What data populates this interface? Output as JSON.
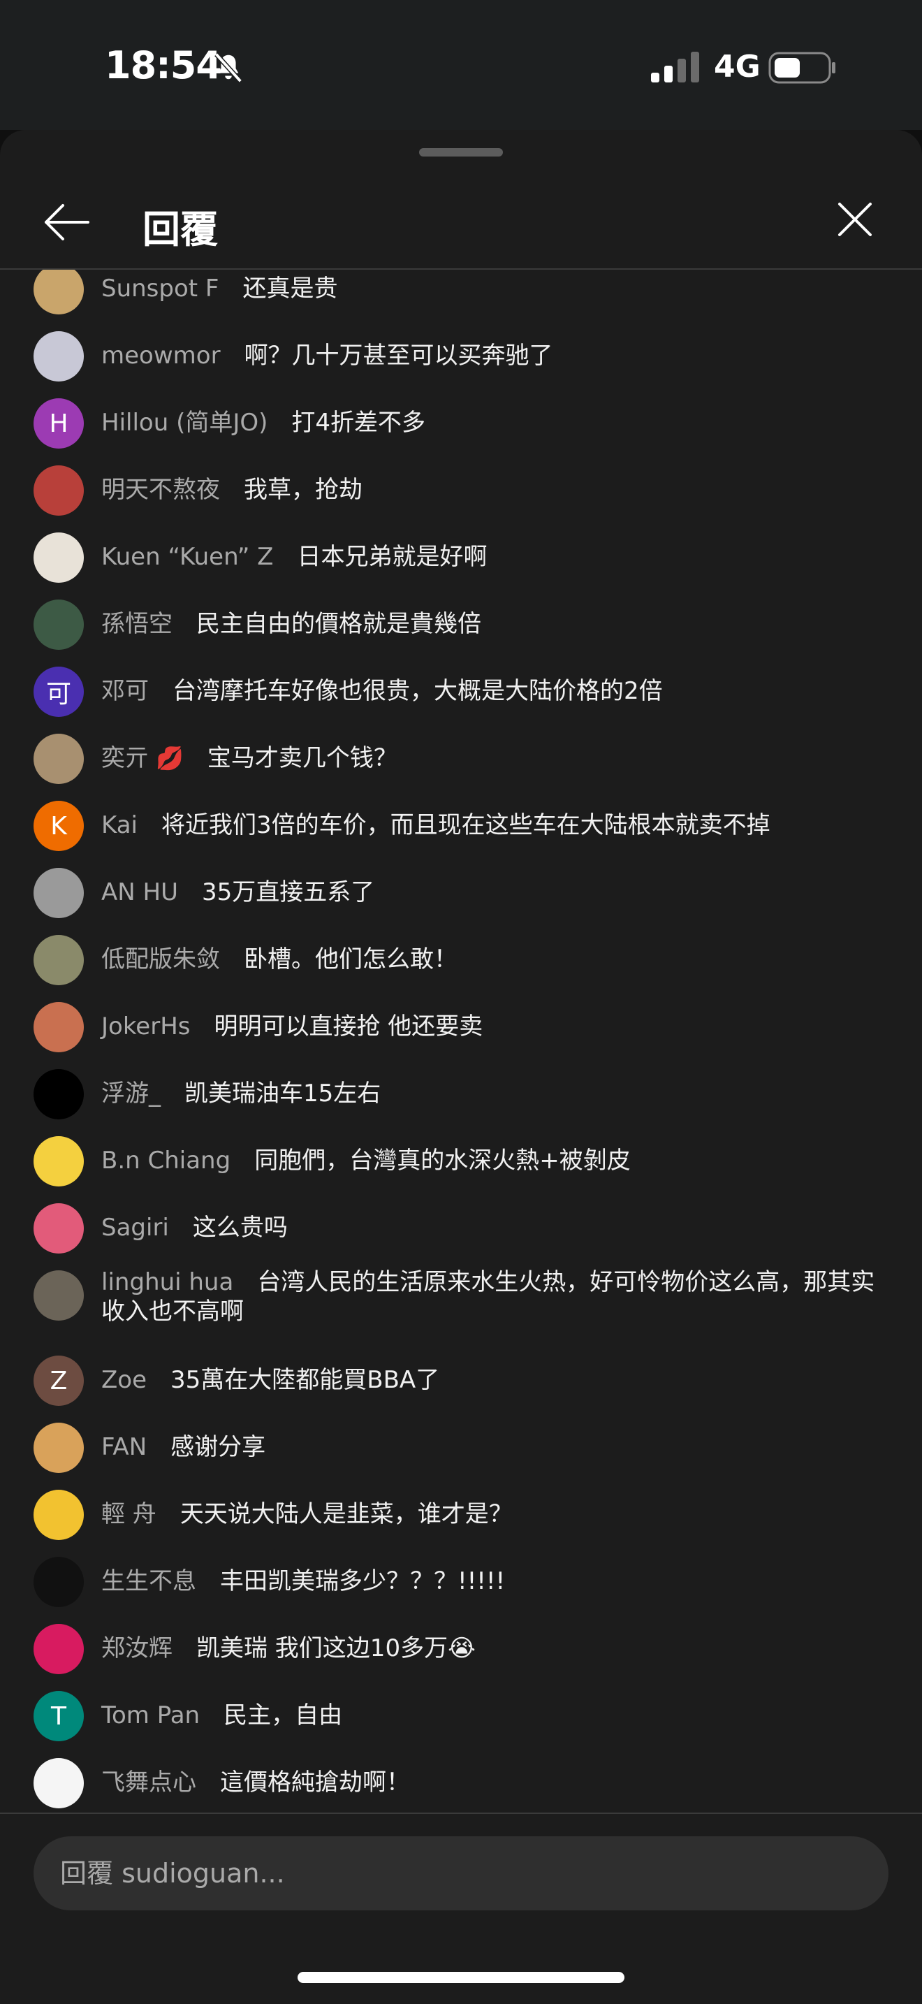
{
  "status_bar": {
    "time": "18:54",
    "network": "4G"
  },
  "header": {
    "title": "回覆"
  },
  "icons": {
    "back": "arrow-left-icon",
    "close": "close-icon",
    "bell": "bell-slash-icon",
    "signal": "signal-icon",
    "battery": "battery-icon"
  },
  "messages": [
    {
      "author": "Sunspot F",
      "text": "还真是贵",
      "avatar_color": "#c9a56b",
      "avatar_letter": ""
    },
    {
      "author": "meowmor",
      "text": "啊？几十万甚至可以买奔驰了",
      "avatar_color": "#c8c8d6",
      "avatar_letter": ""
    },
    {
      "author": "Hillou (简单JO)",
      "text": "打4折差不多",
      "avatar_color": "#9c3bb3",
      "avatar_letter": "H"
    },
    {
      "author": "明天不熬夜",
      "text": "我草，抢劫",
      "avatar_color": "#b8403a",
      "avatar_letter": ""
    },
    {
      "author": "Kuen “Kuen” Z",
      "text": "日本兄弟就是好啊",
      "avatar_color": "#e8e2d8",
      "avatar_letter": ""
    },
    {
      "author": "孫悟空",
      "text": "民主自由的價格就是貴幾倍",
      "avatar_color": "#3d5a45",
      "avatar_letter": ""
    },
    {
      "author": "邓可",
      "text": "台湾摩托车好像也很贵，大概是大陆价格的2倍",
      "avatar_color": "#4a2fb0",
      "avatar_letter": "可"
    },
    {
      "author": "奕亓",
      "badge": "💋",
      "text": "宝马才卖几个钱？",
      "avatar_color": "#a89070",
      "avatar_letter": ""
    },
    {
      "author": "Kai",
      "text": "将近我们3倍的车价，而且现在这些车在大陆根本就卖不掉",
      "avatar_color": "#ef6c00",
      "avatar_letter": "K"
    },
    {
      "author": "AN HU",
      "text": "35万直接五系了",
      "avatar_color": "#9a9a9a",
      "avatar_letter": ""
    },
    {
      "author": "低配版朱敛",
      "text": "卧槽。他们怎么敢！",
      "avatar_color": "#8a8a6a",
      "avatar_letter": ""
    },
    {
      "author": "JokerHs",
      "text": "明明可以直接抢 他还要卖",
      "avatar_color": "#c97050",
      "avatar_letter": ""
    },
    {
      "author": "浮游_",
      "text": "凯美瑞油车15左右",
      "avatar_color": "#000000",
      "avatar_letter": ""
    },
    {
      "author": "B.n Chiang",
      "text": "同胞們，台灣真的水深火熱+被剝皮",
      "avatar_color": "#f4d03f",
      "avatar_letter": ""
    },
    {
      "author": "Sagiri",
      "text": "这么贵吗",
      "avatar_color": "#e25b7a",
      "avatar_letter": ""
    },
    {
      "author": "linghui hua",
      "text": "台湾人民的生活原来水生火热，好可怜物价这么高，那其实收入也不高啊",
      "avatar_color": "#6b6458",
      "avatar_letter": ""
    },
    {
      "author": "Zoe",
      "text": "35萬在大陸都能買BBA了",
      "avatar_color": "#6d4c41",
      "avatar_letter": "Z"
    },
    {
      "author": "FAN",
      "text": "感谢分享",
      "avatar_color": "#d9a25a",
      "avatar_letter": ""
    },
    {
      "author": "輕 舟",
      "text": "天天说大陆人是韭菜，谁才是？",
      "avatar_color": "#f2c230",
      "avatar_letter": ""
    },
    {
      "author": "生生不息",
      "text": "丰田凯美瑞多少？？？!!!!!",
      "avatar_color": "#111111",
      "avatar_letter": ""
    },
    {
      "author": "郑汝辉",
      "text": "凯美瑞 我们这边10多万😭",
      "avatar_color": "#d81b60",
      "avatar_letter": ""
    },
    {
      "author": "Tom Pan",
      "text": "民主，自由",
      "avatar_color": "#00897b",
      "avatar_letter": "T"
    },
    {
      "author": "飞舞点心",
      "text": "這價格純搶劫啊！",
      "avatar_color": "#f5f5f5",
      "avatar_letter": ""
    }
  ],
  "input": {
    "placeholder": "回覆 sudioguan..."
  }
}
